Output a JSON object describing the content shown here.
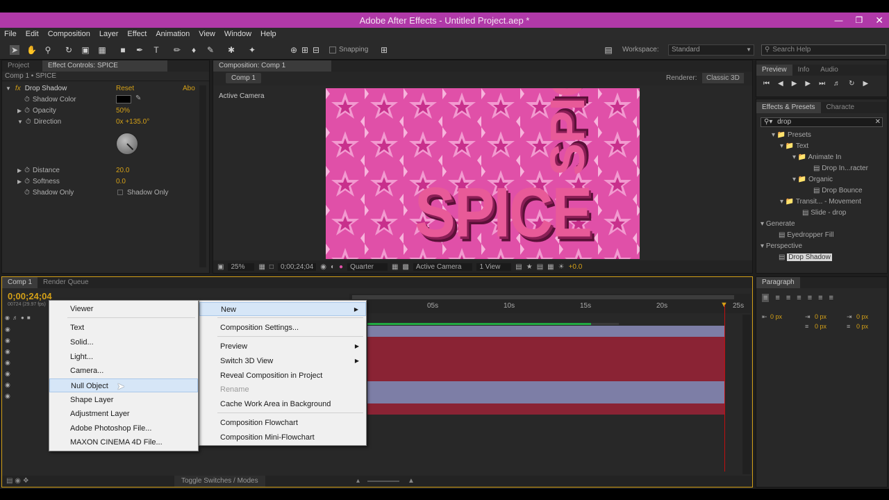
{
  "window": {
    "title": "Adobe After Effects - Untitled Project.aep *"
  },
  "menubar": [
    "File",
    "Edit",
    "Composition",
    "Layer",
    "Effect",
    "Animation",
    "View",
    "Window",
    "Help"
  ],
  "toolbar": {
    "snapping_label": "Snapping",
    "workspace_label": "Workspace:",
    "workspace_value": "Standard",
    "search_placeholder": "Search Help"
  },
  "project_panel": {
    "tabs": [
      "Project",
      "Effect Controls: SPICE"
    ],
    "breadcrumb": "Comp 1 • SPICE",
    "effect_name": "Drop Shadow",
    "reset_label": "Reset",
    "about_label": "Abo",
    "props": [
      {
        "name": "Shadow Color",
        "value": ""
      },
      {
        "name": "Opacity",
        "value": "50%"
      },
      {
        "name": "Direction",
        "value": "0x +135.0°"
      },
      {
        "name": "Distance",
        "value": "20.0"
      },
      {
        "name": "Softness",
        "value": "0.0"
      },
      {
        "name": "Shadow Only",
        "value": "Shadow Only"
      }
    ]
  },
  "composition": {
    "tab": "Composition: Comp 1",
    "comp_tab": "Comp 1",
    "renderer_label": "Renderer:",
    "renderer_value": "Classic 3D",
    "camera_label": "Active Camera",
    "text_main": "SPICE",
    "text_top": "SPIC",
    "footer": {
      "zoom": "25%",
      "timecode": "0;00;24;04",
      "resolution": "Quarter",
      "camera": "Active Camera",
      "view": "1 View",
      "exposure": "+0.0"
    }
  },
  "preview_panel": {
    "tabs": [
      "Preview",
      "Info",
      "Audio"
    ]
  },
  "effects_presets": {
    "tabs": [
      "Effects & Presets",
      "Characte"
    ],
    "search_value": "drop",
    "items": [
      {
        "label": "Presets",
        "indent": 2
      },
      {
        "label": "Text",
        "indent": 3
      },
      {
        "label": "Animate In",
        "indent": 4
      },
      {
        "label": "Drop In...racter",
        "indent": 5
      },
      {
        "label": "Organic",
        "indent": 4
      },
      {
        "label": "Drop Bounce",
        "indent": 5
      },
      {
        "label": "Transit... - Movement",
        "indent": 3
      },
      {
        "label": "Slide - drop",
        "indent": 4
      },
      {
        "label": "Generate",
        "indent": 0
      },
      {
        "label": "Eyedropper Fill",
        "indent": 2
      },
      {
        "label": "Perspective",
        "indent": 0
      },
      {
        "label": "Drop Shadow",
        "indent": 2
      }
    ]
  },
  "timeline": {
    "tabs": [
      "Comp 1",
      "Render Queue"
    ],
    "timecode": "0;00;24;04",
    "subcode": "00724 (29.97 fps)",
    "ruler": [
      "05s",
      "10s",
      "15s",
      "20s",
      "25s"
    ],
    "toggle_label": "Toggle Switches / Modes",
    "tracks": [
      "blue",
      "red",
      "red",
      "red",
      "red",
      "blue",
      "blue",
      "red"
    ]
  },
  "paragraph_panel": {
    "tab": "Paragraph",
    "fields": [
      "0 px",
      "0 px",
      "0 px",
      "0 px",
      "0 px"
    ]
  },
  "context_menu": {
    "items": [
      "New",
      "Composition Settings...",
      "Preview",
      "Switch 3D View",
      "Reveal Composition in Project",
      "Rename",
      "Cache Work Area in Background",
      "Composition Flowchart",
      "Composition Mini-Flowchart"
    ]
  },
  "submenu": {
    "items": [
      "Viewer",
      "Text",
      "Solid...",
      "Light...",
      "Camera...",
      "Null Object",
      "Shape Layer",
      "Adjustment Layer",
      "Adobe Photoshop File...",
      "MAXON CINEMA 4D File..."
    ]
  }
}
